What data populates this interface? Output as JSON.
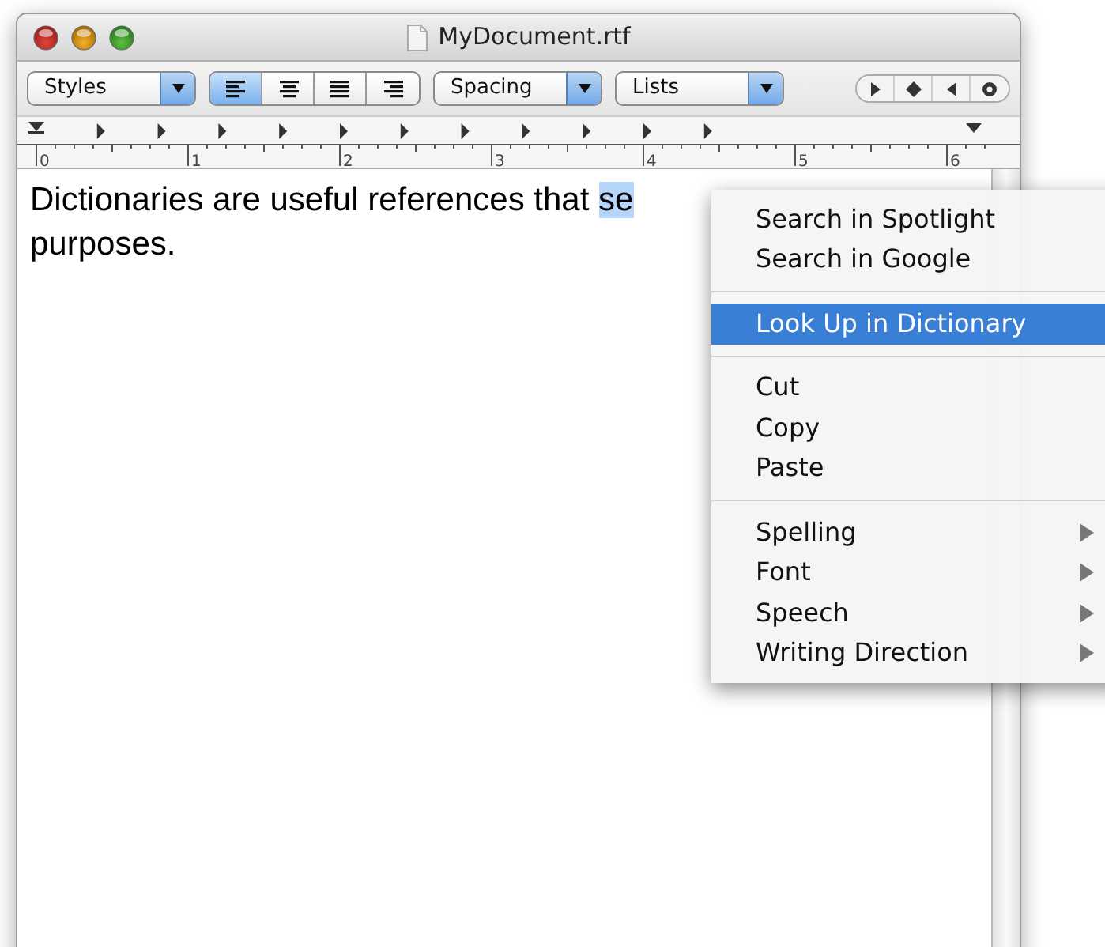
{
  "window": {
    "title": "MyDocument.rtf"
  },
  "toolbar": {
    "styles": {
      "label": "Styles"
    },
    "alignment": [
      {
        "kind": "left",
        "selected": true
      },
      {
        "kind": "center",
        "selected": false
      },
      {
        "kind": "justify",
        "selected": false
      },
      {
        "kind": "right",
        "selected": false
      }
    ],
    "spacing": {
      "label": "Spacing"
    },
    "lists": {
      "label": "Lists"
    },
    "tab_stops": [
      {
        "kind": "right-arrow"
      },
      {
        "kind": "diamond"
      },
      {
        "kind": "left-arrow"
      },
      {
        "kind": "dot"
      }
    ]
  },
  "ruler": {
    "labels": [
      "0",
      "1",
      "2",
      "3",
      "4",
      "5",
      "6"
    ]
  },
  "document": {
    "lines": [
      {
        "text": "Dictionaries are useful references that ",
        "selection": "se"
      },
      {
        "text": "purposes."
      }
    ]
  },
  "context_menu": {
    "groups": [
      [
        {
          "label": "Search in Spotlight",
          "selected": false,
          "submenu": false
        },
        {
          "label": "Search in Google",
          "selected": false,
          "submenu": false
        }
      ],
      [
        {
          "label": "Look Up in Dictionary",
          "selected": true,
          "submenu": false
        }
      ],
      [
        {
          "label": "Cut",
          "selected": false,
          "submenu": false
        },
        {
          "label": "Copy",
          "selected": false,
          "submenu": false
        },
        {
          "label": "Paste",
          "selected": false,
          "submenu": false
        }
      ],
      [
        {
          "label": "Spelling",
          "selected": false,
          "submenu": true
        },
        {
          "label": "Font",
          "selected": false,
          "submenu": true
        },
        {
          "label": "Speech",
          "selected": false,
          "submenu": true
        },
        {
          "label": "Writing Direction",
          "selected": false,
          "submenu": true
        }
      ]
    ]
  }
}
